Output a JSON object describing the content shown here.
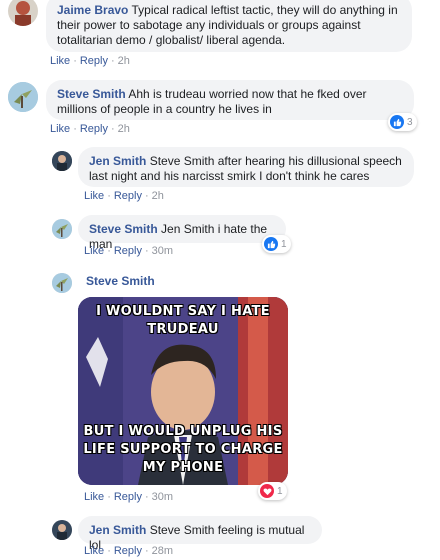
{
  "comments": [
    {
      "name": "Jaime Bravo",
      "text": "Typical radical leftist tactic, they will do anything in their power to sabotage any individuals or groups against totalitarian demo / globalist/ liberal agenda.",
      "like": "Like",
      "reply": "Reply",
      "time": "2h"
    },
    {
      "name": "Steve Smith",
      "text": "Ahh is trudeau worried now that he fked over millions of people in a country he lives in",
      "like": "Like",
      "reply": "Reply",
      "time": "2h",
      "reaction_count": "3"
    },
    {
      "name": "Jen Smith",
      "text": "Steve Smith after hearing his dillusional speech last night and his narcisst smirk I don't think he cares",
      "like": "Like",
      "reply": "Reply",
      "time": "2h"
    },
    {
      "name": "Steve Smith",
      "text": "Jen Smith i hate the man",
      "like": "Like",
      "reply": "Reply",
      "time": "30m",
      "reaction_count": "1"
    },
    {
      "name": "Steve Smith",
      "meme_top": "I WOULDNT SAY I HATE TRUDEAU",
      "meme_bottom": "BUT I WOULD UNPLUG HIS LIFE SUPPORT TO CHARGE MY PHONE",
      "like": "Like",
      "reply": "Reply",
      "time": "30m",
      "reaction_count": "1"
    },
    {
      "name": "Jen Smith",
      "text": "Steve Smith feeling is mutual lol",
      "like": "Like",
      "reply": "Reply",
      "time": "28m"
    }
  ],
  "colors": {
    "link": "#385898",
    "bubble": "#f2f3f5",
    "like_blue": "#1877f2",
    "love_red": "#f0284a"
  },
  "icons": [
    "like-icon",
    "love-icon"
  ]
}
